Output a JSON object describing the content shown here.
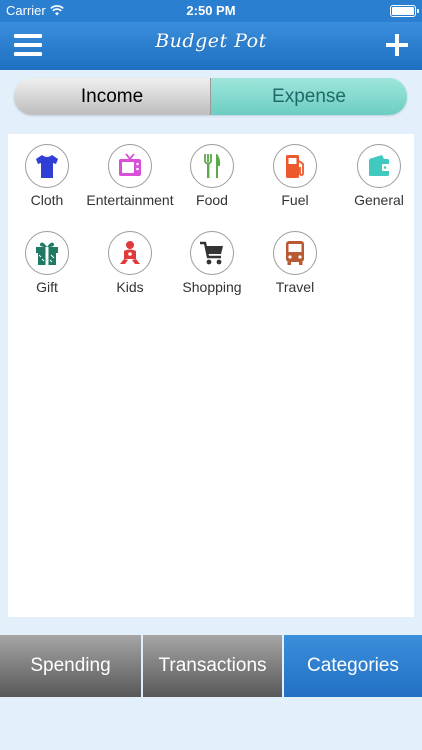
{
  "status_bar": {
    "carrier": "Carrier",
    "time": "2:50 PM"
  },
  "nav": {
    "title": "Budget Pot"
  },
  "segments": [
    {
      "label": "Income",
      "selected": false
    },
    {
      "label": "Expense",
      "selected": true
    }
  ],
  "categories": [
    {
      "label": "Cloth",
      "icon": "tshirt-icon",
      "color": "#2f3fd6"
    },
    {
      "label": "Entertainment",
      "icon": "tv-icon",
      "color": "#d84fd8"
    },
    {
      "label": "Food",
      "icon": "fork-knife-icon",
      "color": "#5da84a"
    },
    {
      "label": "Fuel",
      "icon": "fuel-pump-icon",
      "color": "#ea5a2c"
    },
    {
      "label": "General",
      "icon": "wallet-icon",
      "color": "#3fc9c0"
    },
    {
      "label": "Gift",
      "icon": "gift-icon",
      "color": "#1f7a63"
    },
    {
      "label": "Kids",
      "icon": "baby-icon",
      "color": "#e23a3a"
    },
    {
      "label": "Shopping",
      "icon": "cart-icon",
      "color": "#333333"
    },
    {
      "label": "Travel",
      "icon": "bus-icon",
      "color": "#b85a32"
    }
  ],
  "tabs": [
    {
      "label": "Spending",
      "active": false
    },
    {
      "label": "Transactions",
      "active": false
    },
    {
      "label": "Categories",
      "active": true
    }
  ]
}
